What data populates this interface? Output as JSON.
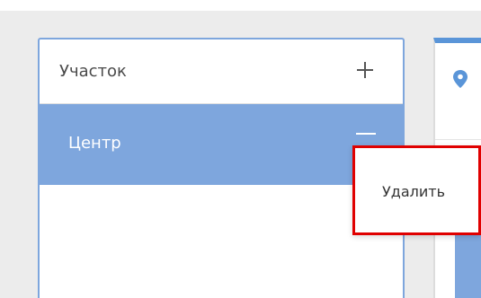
{
  "area_panel": {
    "title": "Участок",
    "add_icon": "plus-icon",
    "items": [
      {
        "label": "Центр",
        "selected": true,
        "action_icon": "minus-icon"
      }
    ]
  },
  "details_panel": {
    "icon": "location-pin-icon"
  },
  "context_menu": {
    "items": [
      {
        "label": "Удалить"
      }
    ]
  },
  "colors": {
    "accent": "#7ea6dd",
    "header_accent": "#5a95d8",
    "highlight_border": "#e00000"
  }
}
